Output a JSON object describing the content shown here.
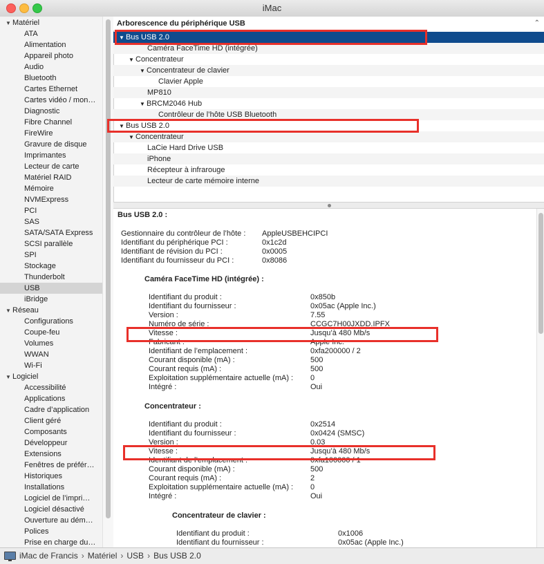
{
  "window": {
    "title": "iMac"
  },
  "sidebar": {
    "groups": [
      {
        "label": "Matériel",
        "items": [
          "ATA",
          "Alimentation",
          "Appareil photo",
          "Audio",
          "Bluetooth",
          "Cartes Ethernet",
          "Cartes vidéo / mon…",
          "Diagnostic",
          "Fibre Channel",
          "FireWire",
          "Gravure de disque",
          "Imprimantes",
          "Lecteur de carte",
          "Matériel RAID",
          "Mémoire",
          "NVMExpress",
          "PCI",
          "SAS",
          "SATA/SATA Express",
          "SCSI parallèle",
          "SPI",
          "Stockage",
          "Thunderbolt",
          "USB",
          "iBridge"
        ]
      },
      {
        "label": "Réseau",
        "items": [
          "Configurations",
          "Coupe-feu",
          "Volumes",
          "WWAN",
          "Wi-Fi"
        ]
      },
      {
        "label": "Logiciel",
        "items": [
          "Accessibilité",
          "Applications",
          "Cadre d’application",
          "Client géré",
          "Composants",
          "Développeur",
          "Extensions",
          "Fenêtres de préfér…",
          "Historiques",
          "Installations",
          "Logiciel de l’impri…",
          "Logiciel désactivé",
          "Ouverture au dém…",
          "Polices",
          "Prise en charge du…"
        ]
      }
    ],
    "selected": "USB"
  },
  "tree": {
    "header": "Arborescence du périphérique USB",
    "rows": [
      {
        "label": "Bus USB 2.0",
        "level": 0,
        "expanded": true,
        "selected": true
      },
      {
        "label": "Caméra FaceTime HD (intégrée)",
        "level": 2
      },
      {
        "label": "Concentrateur",
        "level": 1,
        "expanded": true
      },
      {
        "label": "Concentrateur de clavier",
        "level": 2,
        "expanded": true
      },
      {
        "label": "Clavier Apple",
        "level": 3
      },
      {
        "label": "MP810",
        "level": 2
      },
      {
        "label": "BRCM2046 Hub",
        "level": 2,
        "expanded": true
      },
      {
        "label": "Contrôleur de l’hôte USB Bluetooth",
        "level": 3
      },
      {
        "label": "Bus USB 2.0",
        "level": 0,
        "expanded": true
      },
      {
        "label": "Concentrateur",
        "level": 1,
        "expanded": true
      },
      {
        "label": "LaCie Hard Drive USB",
        "level": 2
      },
      {
        "label": "iPhone",
        "level": 2
      },
      {
        "label": "Récepteur à infrarouge",
        "level": 2
      },
      {
        "label": "Lecteur de carte mémoire interne",
        "level": 2
      }
    ]
  },
  "detail": {
    "title": "Bus USB 2.0 :",
    "controller": [
      [
        "Gestionnaire du contrôleur de l’hôte :",
        "AppleUSBEHCIPCI"
      ],
      [
        "Identifiant du périphérique PCI :",
        "0x1c2d"
      ],
      [
        "Identifiant de révision du PCI :",
        "0x0005"
      ],
      [
        "Identifiant du fournisseur du PCI :",
        "0x8086"
      ]
    ],
    "camera": {
      "title": "Caméra FaceTime HD (intégrée) :",
      "rows": [
        [
          "Identifiant du produit :",
          "0x850b"
        ],
        [
          "Identifiant du fournisseur :",
          "0x05ac (Apple Inc.)"
        ],
        [
          "Version :",
          "7.55"
        ],
        [
          "Numéro de série :",
          "CCGC7H00JXDD.IPFX"
        ],
        [
          "Vitesse :",
          "Jusqu’à 480 Mb/s"
        ],
        [
          "Fabricant :",
          "Apple Inc."
        ],
        [
          "Identifiant de l’emplacement :",
          "0xfa200000 / 2"
        ],
        [
          "Courant disponible (mA) :",
          "500"
        ],
        [
          "Courant requis (mA) :",
          "500"
        ],
        [
          "Exploitation supplémentaire actuelle (mA) :",
          "0"
        ],
        [
          "Intégré :",
          "Oui"
        ]
      ]
    },
    "hub": {
      "title": "Concentrateur :",
      "rows": [
        [
          "Identifiant du produit :",
          "0x2514"
        ],
        [
          "Identifiant du fournisseur :",
          "0x0424  (SMSC)"
        ],
        [
          "Version :",
          "0.03"
        ],
        [
          "Vitesse :",
          "Jusqu’à 480 Mb/s"
        ],
        [
          "Identifiant de l’emplacement :",
          "0xfa100000 / 1"
        ],
        [
          "Courant disponible (mA) :",
          "500"
        ],
        [
          "Courant requis (mA) :",
          "2"
        ],
        [
          "Exploitation supplémentaire actuelle (mA) :",
          "0"
        ],
        [
          "Intégré :",
          "Oui"
        ]
      ]
    },
    "keyboard_hub": {
      "title": "Concentrateur de clavier :",
      "rows": [
        [
          "Identifiant du produit :",
          "0x1006"
        ],
        [
          "Identifiant du fournisseur :",
          "0x05ac (Apple Inc.)"
        ]
      ]
    }
  },
  "statusbar": {
    "crumbs": [
      "iMac de Francis",
      "Matériel",
      "USB",
      "Bus USB 2.0"
    ],
    "separator": "›"
  },
  "colors": {
    "selection": "#0f4b8d",
    "highlight": "#e8302a",
    "sidebar_selected": "#d4d4d4"
  }
}
